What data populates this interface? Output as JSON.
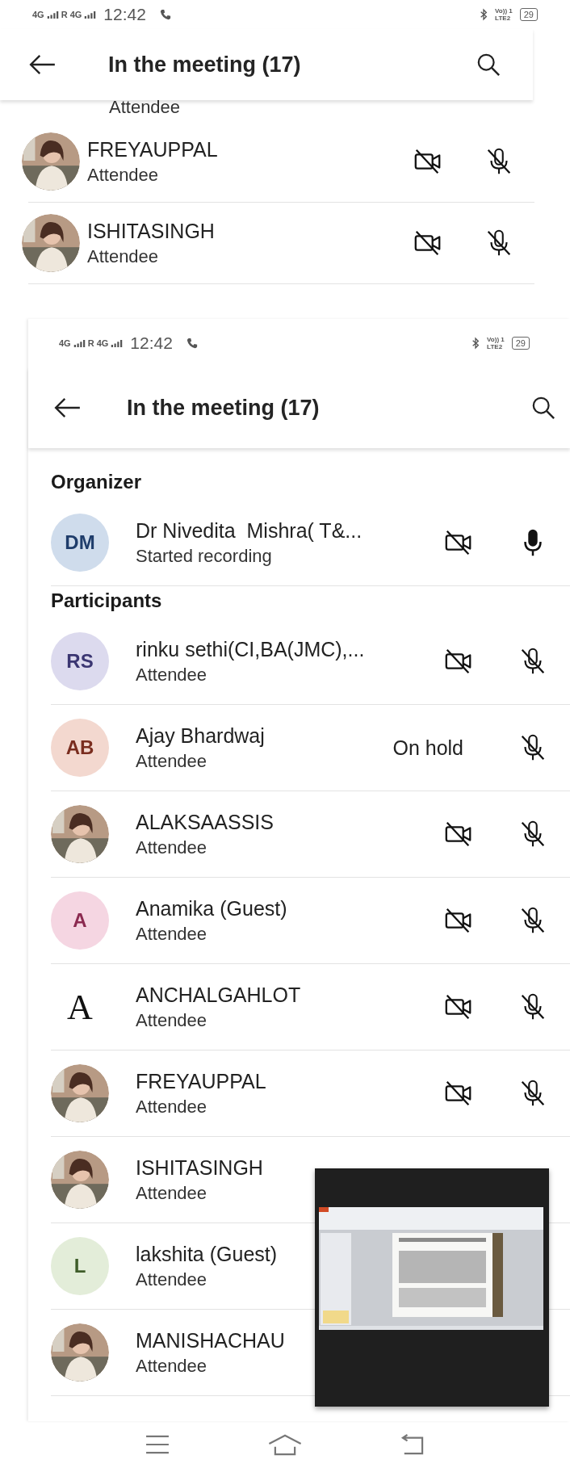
{
  "background_screen": {
    "status_bar": {
      "network_1": "4G",
      "roaming": "R",
      "network_2": "4G",
      "time": "12:42",
      "volte": "Vo)) 1",
      "lte": "LTE2",
      "battery": "29"
    },
    "header": {
      "title": "In the meeting (17)"
    },
    "cut_row": {
      "role": "Attendee"
    },
    "participants": [
      {
        "name": "FREYAUPPAL",
        "role": "Attendee",
        "camera_off": true,
        "muted": true
      },
      {
        "name": "ISHITASINGH",
        "role": "Attendee",
        "camera_off": true,
        "muted": true
      }
    ]
  },
  "front_screen": {
    "status_bar": {
      "network_1": "4G",
      "roaming": "R",
      "network_2": "4G",
      "time": "12:42",
      "volte": "Vo)) 1",
      "lte": "LTE2",
      "battery": "29"
    },
    "header": {
      "title": "In the meeting (17)"
    },
    "sections": [
      {
        "title": "Organizer",
        "people": [
          {
            "name": "Dr Nivedita  Mishra( T&...",
            "role": "Started recording",
            "avatar": {
              "kind": "initials",
              "text": "DM",
              "color": "#cfdcec"
            },
            "camera_off": true,
            "muted": false
          }
        ]
      },
      {
        "title": "Participants",
        "people": [
          {
            "name": "rinku sethi(CI,BA(JMC),...",
            "role": "Attendee",
            "avatar": {
              "kind": "initials",
              "text": "RS",
              "color": "#dcdaee"
            },
            "camera_off": true,
            "muted": true
          },
          {
            "name": "Ajay Bhardwaj",
            "role": "Attendee",
            "avatar": {
              "kind": "initials",
              "text": "AB",
              "color": "#f3d8cf"
            },
            "status": "On hold",
            "muted": true
          },
          {
            "name": "ALAKSAASSIS",
            "role": "Attendee",
            "camera_off": true,
            "muted": true
          },
          {
            "name": "Anamika (Guest)",
            "role": "Attendee",
            "avatar": {
              "kind": "initials",
              "text": "A",
              "color": "#f5d6e2"
            },
            "camera_off": true,
            "muted": true
          },
          {
            "name": "ANCHALGAHLOT",
            "role": "Attendee",
            "avatar": {
              "kind": "letter",
              "text": "A"
            },
            "camera_off": true,
            "muted": true
          },
          {
            "name": "FREYAUPPAL",
            "role": "Attendee",
            "camera_off": true,
            "muted": true
          },
          {
            "name": "ISHITASINGH",
            "role": "Attendee"
          },
          {
            "name": "lakshita (Guest)",
            "role": "Attendee",
            "avatar": {
              "kind": "initials",
              "text": "L",
              "color": "#e3edd9"
            }
          },
          {
            "name": "MANISHACHAU",
            "role": "Attendee"
          }
        ]
      }
    ]
  }
}
